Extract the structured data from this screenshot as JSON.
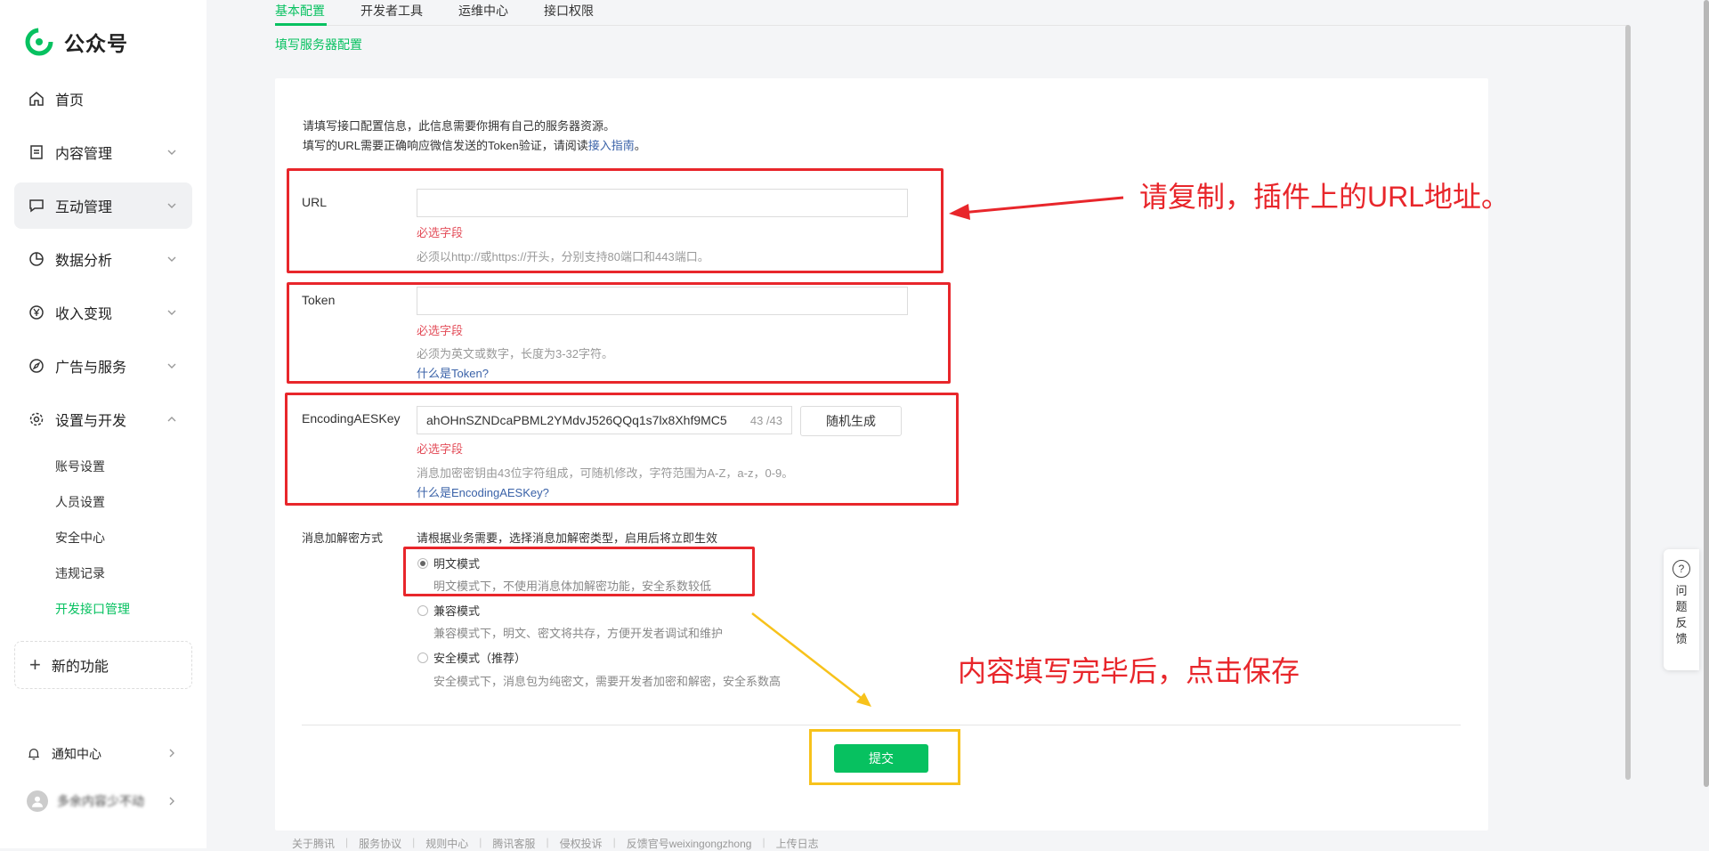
{
  "app": {
    "title": "公众号"
  },
  "sidebar": {
    "items": [
      {
        "label": "首页"
      },
      {
        "label": "内容管理"
      },
      {
        "label": "互动管理"
      },
      {
        "label": "数据分析"
      },
      {
        "label": "收入变现"
      },
      {
        "label": "广告与服务"
      },
      {
        "label": "设置与开发"
      }
    ],
    "subitems": [
      {
        "label": "账号设置"
      },
      {
        "label": "人员设置"
      },
      {
        "label": "安全中心"
      },
      {
        "label": "违规记录"
      },
      {
        "label": "开发接口管理"
      }
    ],
    "new_feature": "新的功能",
    "notification": "通知中心",
    "username": "多余内容少不动"
  },
  "tabs": [
    {
      "label": "基本配置"
    },
    {
      "label": "开发者工具"
    },
    {
      "label": "运维中心"
    },
    {
      "label": "接口权限"
    }
  ],
  "breadcrumb": "填写服务器配置",
  "intro": {
    "line1": "请填写接口配置信息，此信息需要你拥有自己的服务器资源。",
    "line2_pre": "填写的URL需要正确响应微信发送的Token验证，请阅读",
    "line2_link": "接入指南",
    "line2_post": "。"
  },
  "form": {
    "url": {
      "label": "URL",
      "value": "",
      "required": "必选字段",
      "hint": "必须以http://或https://开头，分别支持80端口和443端口。"
    },
    "token": {
      "label": "Token",
      "value": "",
      "required": "必选字段",
      "hint": "必须为英文或数字，长度为3-32字符。",
      "help": "什么是Token?"
    },
    "aes": {
      "label": "EncodingAESKey",
      "value": "ahOHnSZNDcaPBML2YMdvJ526QQq1s7lx8Xhf9MC5",
      "count": "43 /43",
      "generate": "随机生成",
      "required": "必选字段",
      "hint": "消息加密密钥由43位字符组成，可随机修改，字符范围为A-Z，a-z，0-9。",
      "help": "什么是EncodingAESKey?"
    },
    "encrypt": {
      "label": "消息加解密方式",
      "desc": "请根据业务需要，选择消息加解密类型，启用后将立即生效",
      "options": [
        {
          "label": "明文模式",
          "desc": "明文模式下，不使用消息体加解密功能，安全系数较低"
        },
        {
          "label": "兼容模式",
          "desc": "兼容模式下，明文、密文将共存，方便开发者调试和维护"
        },
        {
          "label": "安全模式（推荐）",
          "desc": "安全模式下，消息包为纯密文，需要开发者加密和解密，安全系数高"
        }
      ]
    },
    "submit": "提交"
  },
  "annotations": {
    "url_note": "请复制，插件上的URL地址。",
    "save_note": "内容填写完毕后，点击保存"
  },
  "feedback": "问题反馈",
  "footer": {
    "links": [
      "关于腾讯",
      "服务协议",
      "规则中心",
      "腾讯客服",
      "侵权投诉",
      "反馈官号weixingongzhong",
      "上传日志"
    ]
  },
  "colors": {
    "brand": "#07c160",
    "annotation_red": "#e8262b",
    "annotation_yellow": "#f7c21b",
    "link": "#3a62a8"
  }
}
